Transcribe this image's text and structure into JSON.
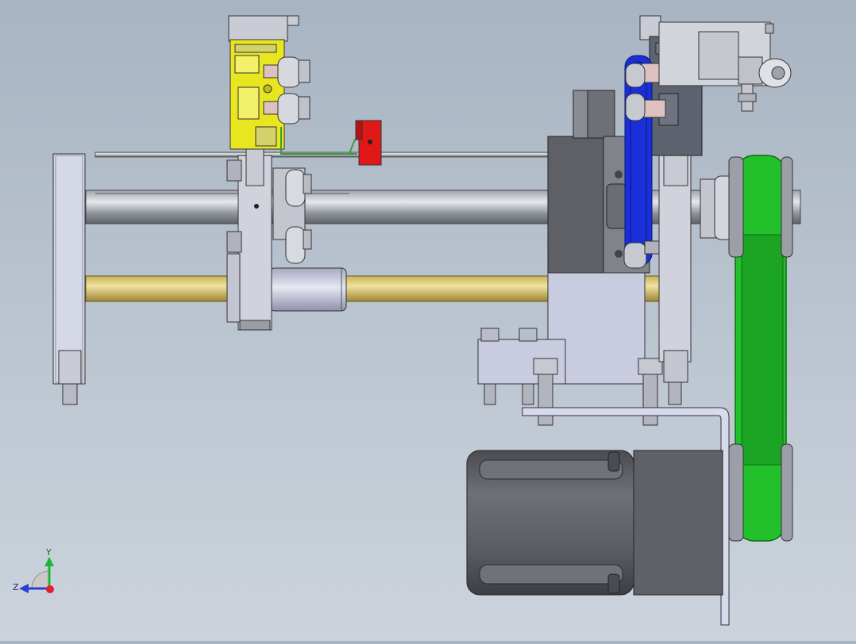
{
  "triad": {
    "y_label": "Y",
    "z_label": "Z",
    "y_axis_color": "#1fb53a",
    "z_axis_color": "#2a3fd6",
    "x_axis_color": "#e0202a"
  },
  "parts": {
    "yellow_bracket_color": "#e8e61e",
    "red_block_color": "#e01818",
    "blue_belt_color": "#1a2fd8",
    "green_belt_color": "#22c02a",
    "brass_rod_color": "#d7c46a",
    "icons": [
      "axis-triad-icon"
    ]
  }
}
